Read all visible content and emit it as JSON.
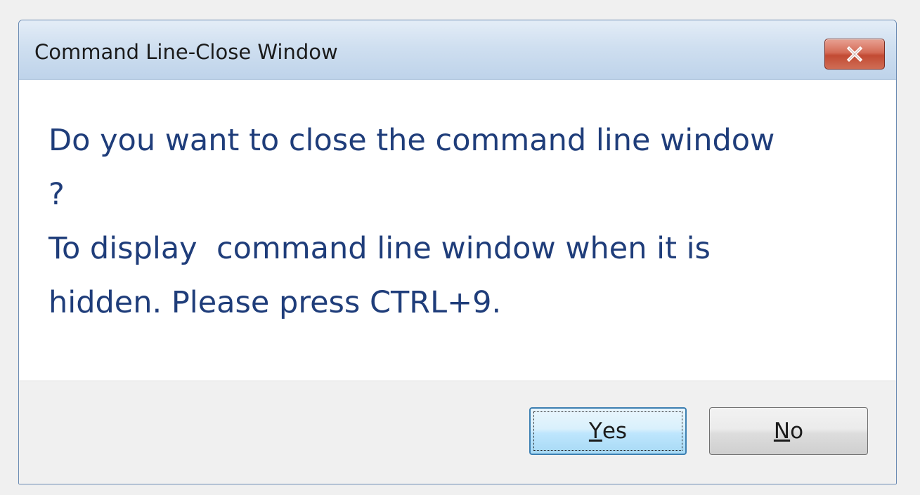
{
  "window": {
    "title": "Command Line-Close Window",
    "close_icon": "close-x-icon"
  },
  "message": {
    "line1": "Do you want to close the command line window",
    "line2": "?",
    "line3": "To display  command line window when it is",
    "line4": "hidden. Please press CTRL+9."
  },
  "buttons": {
    "yes": {
      "mnemonic": "Y",
      "rest": "es",
      "focused": true
    },
    "no": {
      "mnemonic": "N",
      "rest": "o"
    }
  },
  "colors": {
    "message_text": "#1f3d7a",
    "close_button": "#c24a33",
    "focused_button_border": "#3c7fb1"
  }
}
